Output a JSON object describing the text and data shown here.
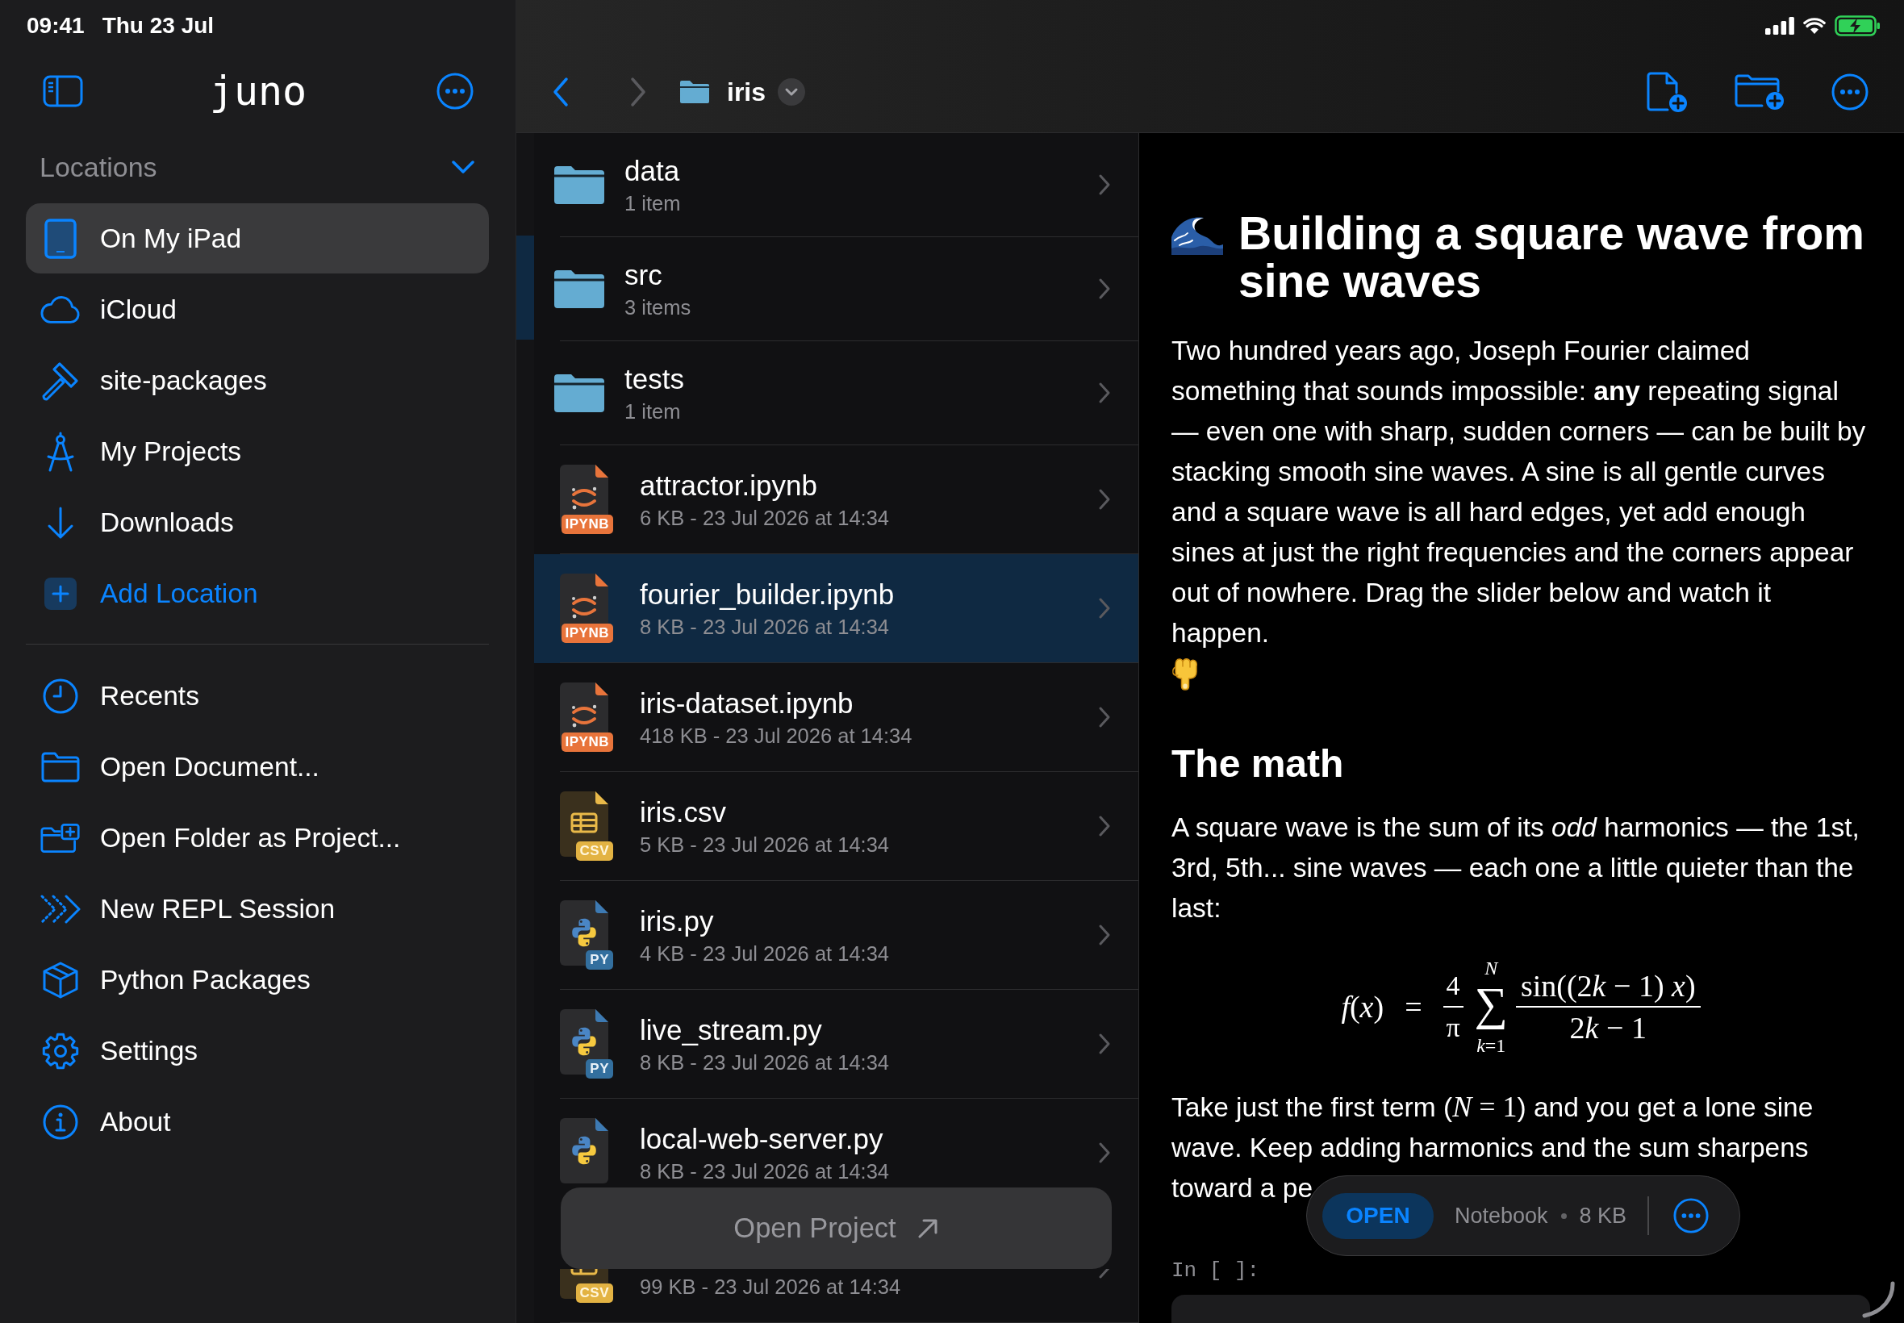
{
  "status_bar": {
    "time": "09:41",
    "date": "Thu 23 Jul"
  },
  "sidebar": {
    "title": "juno",
    "section": {
      "label": "Locations",
      "expanded": true
    },
    "locations": [
      {
        "label": "On My iPad",
        "kind": "place",
        "selected": true
      },
      {
        "label": "iCloud",
        "kind": "place",
        "selected": false
      },
      {
        "label": "site-packages",
        "kind": "place",
        "selected": false
      },
      {
        "label": "My Projects",
        "kind": "place",
        "selected": false
      },
      {
        "label": "Downloads",
        "kind": "place",
        "selected": false
      },
      {
        "label": "Add Location",
        "kind": "add",
        "selected": false
      }
    ],
    "actions": [
      "Recents",
      "Open Document...",
      "Open Folder as Project...",
      "New REPL Session",
      "Python Packages",
      "Settings",
      "About"
    ]
  },
  "browser": {
    "back_enabled": true,
    "forward_enabled": false,
    "folder": "iris",
    "files": [
      {
        "kind": "folder",
        "name": "data",
        "detail": "1 item",
        "selected": false
      },
      {
        "kind": "folder",
        "name": "src",
        "detail": "3 items",
        "selected": false
      },
      {
        "kind": "folder",
        "name": "tests",
        "detail": "1 item",
        "selected": false
      },
      {
        "kind": "ipynb",
        "name": "attractor.ipynb",
        "badge": "IPYNB",
        "detail": "6 KB - 23 Jul 2026 at 14:34",
        "selected": false
      },
      {
        "kind": "ipynb",
        "name": "fourier_builder.ipynb",
        "badge": "IPYNB",
        "detail": "8 KB - 23 Jul 2026 at 14:34",
        "selected": true
      },
      {
        "kind": "ipynb",
        "name": "iris-dataset.ipynb",
        "badge": "IPYNB",
        "detail": "418 KB - 23 Jul 2026 at 14:34",
        "selected": false
      },
      {
        "kind": "csv",
        "name": "iris.csv",
        "badge": "CSV",
        "detail": "5 KB - 23 Jul 2026 at 14:34",
        "selected": false
      },
      {
        "kind": "py",
        "name": "iris.py",
        "badge": "PY",
        "detail": "4 KB - 23 Jul 2026 at 14:34",
        "selected": false
      },
      {
        "kind": "py",
        "name": "live_stream.py",
        "badge": "PY",
        "detail": "8 KB - 23 Jul 2026 at 14:34",
        "selected": false
      },
      {
        "kind": "py",
        "name": "local-web-server.py",
        "detail": "8 KB - 23 Jul 2026 at 14:34",
        "selected": false
      },
      {
        "kind": "csv",
        "badge": "CSV",
        "detail": "99 KB - 23 Jul 2026 at 14:34",
        "selected": false
      }
    ],
    "open_project": "Open Project"
  },
  "preview": {
    "blocks": [
      {
        "kind": "title",
        "text": "Building a square wave from sine waves"
      },
      {
        "kind": "paragraph",
        "runs": [
          {
            "kind": "text",
            "text": "Two hundred years ago, Joseph Fourier claimed something that sounds impossible: **any** repeating signal — even one with sharp, sudden corners — can be built by stacking smooth sine waves. A sine is all gentle curves and a square wave is all hard edges, yet add enough sines at just the right frequencies and the corners appear out of nowhere. Drag the slider below and watch it happen."
          }
        ]
      },
      {
        "kind": "heading",
        "text": "The math"
      },
      {
        "kind": "paragraph",
        "runs": [
          {
            "kind": "text",
            "text": "A square wave is the sum of its *odd* harmonics — the 1st, 3rd, 5th... sine waves — each one a little quieter than the last:"
          }
        ]
      },
      {
        "kind": "formula",
        "lhs": [
          {
            "kind": "var",
            "text": "f"
          },
          {
            "kind": "text",
            "text": "("
          },
          {
            "kind": "var",
            "text": "x"
          },
          {
            "kind": "text",
            "text": ")"
          }
        ],
        "relation": "=",
        "coefficient": {
          "numerator": [
            {
              "kind": "text",
              "text": "4"
            }
          ],
          "denominator": [
            {
              "kind": "text",
              "text": "π"
            }
          ]
        },
        "sum": {
          "symbol": "∑",
          "upper": [
            {
              "kind": "var",
              "text": "N"
            }
          ],
          "lower": [
            {
              "kind": "var",
              "text": "k"
            },
            {
              "kind": "text",
              "text": "=1"
            }
          ]
        },
        "fraction": {
          "numerator": [
            {
              "kind": "text",
              "text": "sin((2"
            },
            {
              "kind": "var",
              "text": "k"
            },
            {
              "kind": "text",
              "text": " − 1) "
            },
            {
              "kind": "var",
              "text": "x"
            },
            {
              "kind": "text",
              "text": ")"
            }
          ],
          "denominator": [
            {
              "kind": "text",
              "text": "2"
            },
            {
              "kind": "var",
              "text": "k"
            },
            {
              "kind": "text",
              "text": " − 1"
            }
          ]
        }
      },
      {
        "kind": "paragraph",
        "runs": [
          {
            "kind": "text",
            "text": "Take just the first term ("
          },
          {
            "kind": "math",
            "text": "*N* = 1"
          },
          {
            "kind": "text",
            "text": ") and you get a lone sine wave. Keep adding harmonics and the sum sharpens toward a pe"
          }
        ]
      },
      {
        "kind": "prompt",
        "text": "In [ ]:"
      },
      {
        "kind": "code_cell"
      }
    ]
  },
  "file_bar": {
    "action": "OPEN",
    "kind": "Notebook",
    "size": "8 KB"
  }
}
